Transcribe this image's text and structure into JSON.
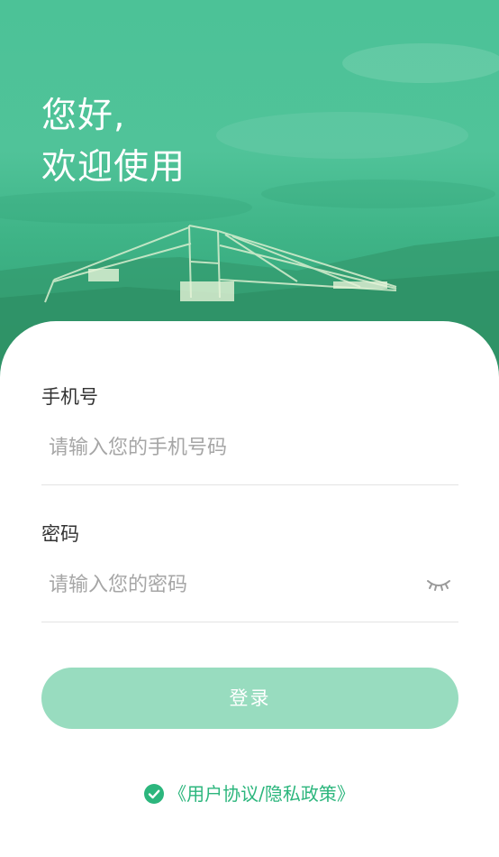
{
  "hero": {
    "greeting_line1": "您好,",
    "greeting_line2": "欢迎使用"
  },
  "form": {
    "phone": {
      "label": "手机号",
      "placeholder": "请输入您的手机号码",
      "value": ""
    },
    "password": {
      "label": "密码",
      "placeholder": "请输入您的密码",
      "value": "",
      "toggle_icon": "eye-closed-icon"
    }
  },
  "actions": {
    "login_label": "登录"
  },
  "agreement": {
    "checked": true,
    "check_icon": "check-circle-icon",
    "link_text": "《用户协议/隐私政策》"
  },
  "colors": {
    "brand_green": "#2cb67d",
    "hero_green": "#4cc297",
    "button_disabled": "#98dcbf",
    "placeholder": "#a6a6a6",
    "label": "#333333",
    "divider": "#e3e3e3"
  }
}
